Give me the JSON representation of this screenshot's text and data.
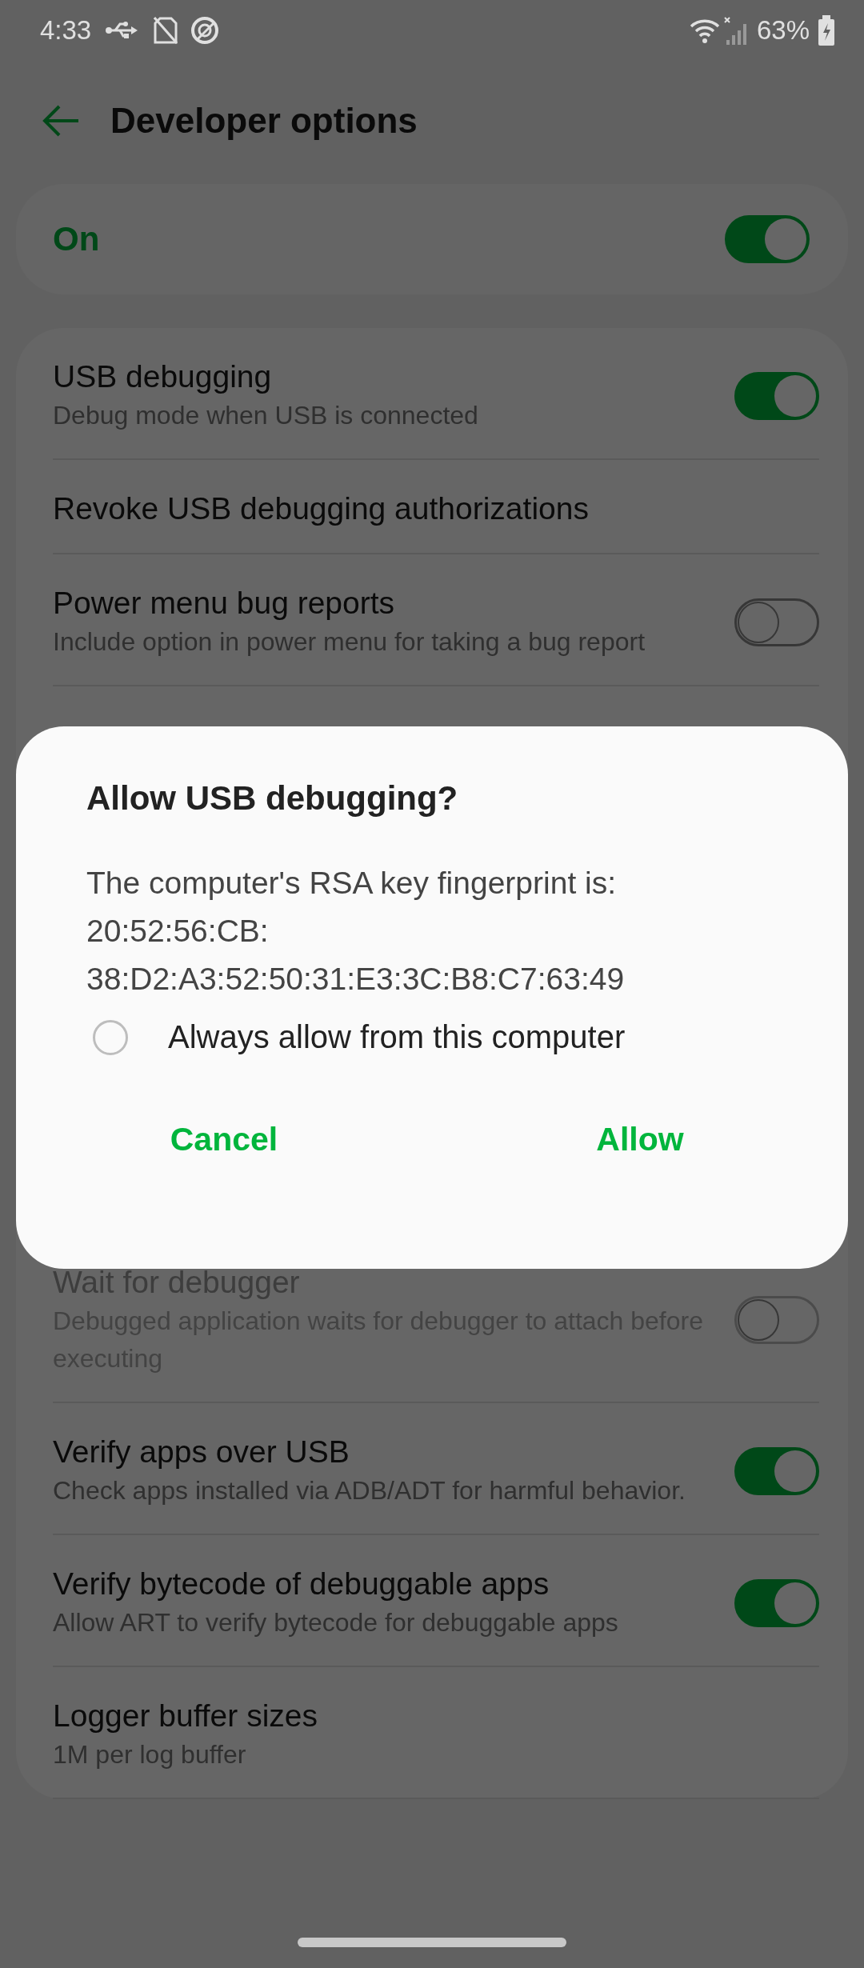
{
  "status_bar": {
    "time": "4:33",
    "battery": "63%"
  },
  "header": {
    "title": "Developer options"
  },
  "master": {
    "label": "On",
    "on": true
  },
  "settings": [
    {
      "title": "USB debugging",
      "subtitle": "Debug mode when USB is connected",
      "kind": "toggle",
      "on": true,
      "disabled": false
    },
    {
      "title": "Revoke USB debugging authorizations",
      "kind": "plain",
      "disabled": false
    },
    {
      "title": "Power menu bug reports",
      "subtitle": "Include option in power menu for taking a bug report",
      "kind": "toggle",
      "on": false,
      "disabled": false
    },
    {
      "title": "Wait for debugger",
      "subtitle": "Debugged application waits for debugger to attach before executing",
      "kind": "toggle",
      "on": false,
      "disabled": true
    },
    {
      "title": "Verify apps over USB",
      "subtitle": "Check apps installed via ADB/ADT for harmful behavior.",
      "kind": "toggle",
      "on": true,
      "disabled": false
    },
    {
      "title": "Verify bytecode of debuggable apps",
      "subtitle": "Allow ART to verify bytecode for debuggable apps",
      "kind": "toggle",
      "on": true,
      "disabled": false
    },
    {
      "title": "Logger buffer sizes",
      "subtitle": "1M per log buffer",
      "kind": "plain",
      "disabled": false
    }
  ],
  "dialog": {
    "title": "Allow USB debugging?",
    "message_lines": [
      "The computer's RSA key fingerprint is:",
      "20:52:56:CB:",
      "38:D2:A3:52:50:31:E3:3C:B8:C7:63:49"
    ],
    "checkbox": {
      "label": "Always allow from this computer",
      "checked": false
    },
    "buttons": [
      "Cancel",
      "Allow"
    ]
  }
}
